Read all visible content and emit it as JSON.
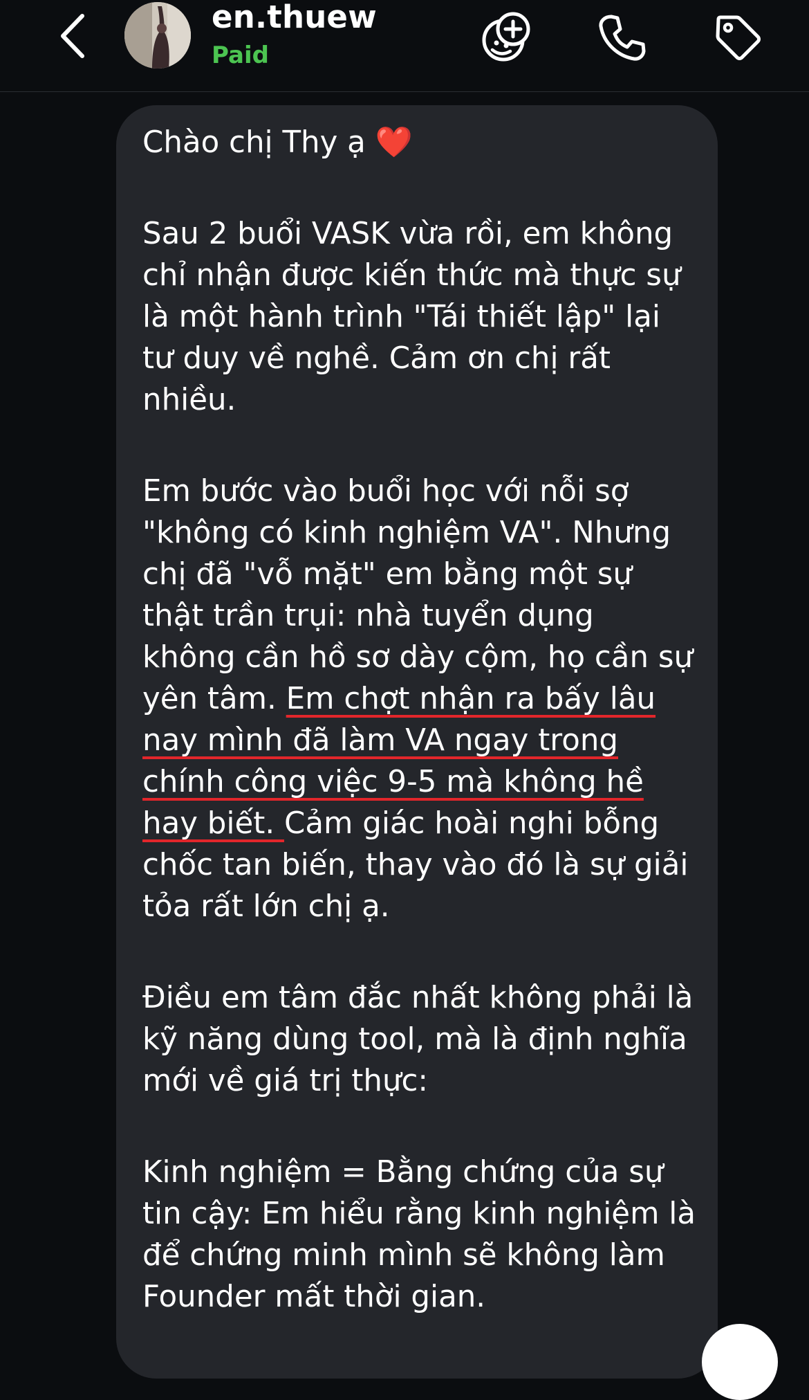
{
  "header": {
    "username": "en.thuew",
    "status": "Paid",
    "icons": {
      "back": "chevron-left-icon",
      "group_add": "group-add-icon",
      "phone": "phone-icon",
      "tag": "tag-icon"
    }
  },
  "colors": {
    "background": "#0b0d10",
    "bubble": "#24262b",
    "status": "#4cc451",
    "underline": "#e2262b",
    "heart": "#e8212f"
  },
  "message": {
    "greeting": "Chào chị Thy ạ",
    "greeting_emoji": "❤️",
    "p1": "Sau 2 buổi VASK vừa rồi, em không chỉ nhận được kiến thức mà thực sự là một hành trình \"Tái thiết lập\" lại tư duy về nghề. Cảm ơn chị rất nhiều.",
    "p2_before": "Em bước vào buổi học với nỗi sợ \"không có kinh nghiệm VA\". Nhưng chị đã \"vỗ mặt\" em bằng một sự thật trần trụi: nhà tuyển dụng không cần hồ sơ dày cộm, họ cần sự yên tâm. ",
    "p2_underlined": "Em chợt nhận ra bấy lâu nay mình đã làm VA ngay trong chính công việc 9-5 mà không hề hay biết. ",
    "p2_after": "Cảm giác hoài nghi bỗng chốc tan biến, thay vào đó là sự giải tỏa rất lớn chị ạ.",
    "p3": "Điều em tâm đắc nhất không phải là kỹ năng dùng tool, mà là định nghĩa mới về giá trị thực:",
    "p4": "Kinh nghiệm = Bằng chứng của sự tin cậy: Em hiểu rằng kinh nghiệm là để chứng minh mình sẽ không làm Founder mất thời gian."
  }
}
